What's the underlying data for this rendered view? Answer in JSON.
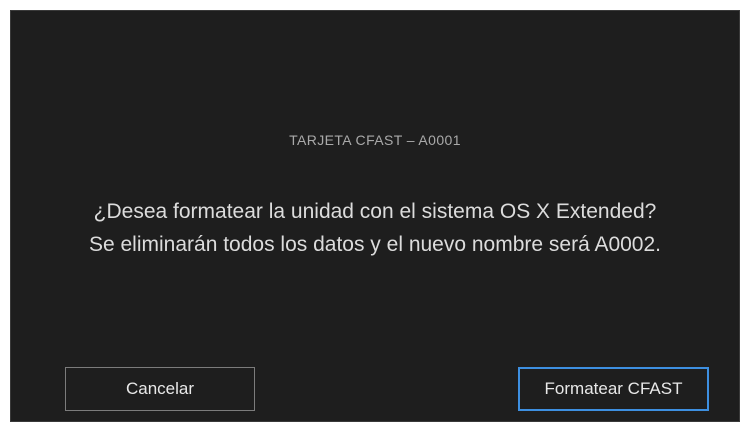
{
  "dialog": {
    "card_label": "TARJETA CFAST – A0001",
    "message_line1": "¿Desea formatear la unidad con el sistema OS X Extended?",
    "message_line2": "Se eliminarán todos los datos y el nuevo nombre será A0002."
  },
  "buttons": {
    "cancel_label": "Cancelar",
    "format_label": "Formatear CFAST"
  },
  "colors": {
    "background": "#1e1e1e",
    "accent_border": "#3d8fe0"
  }
}
